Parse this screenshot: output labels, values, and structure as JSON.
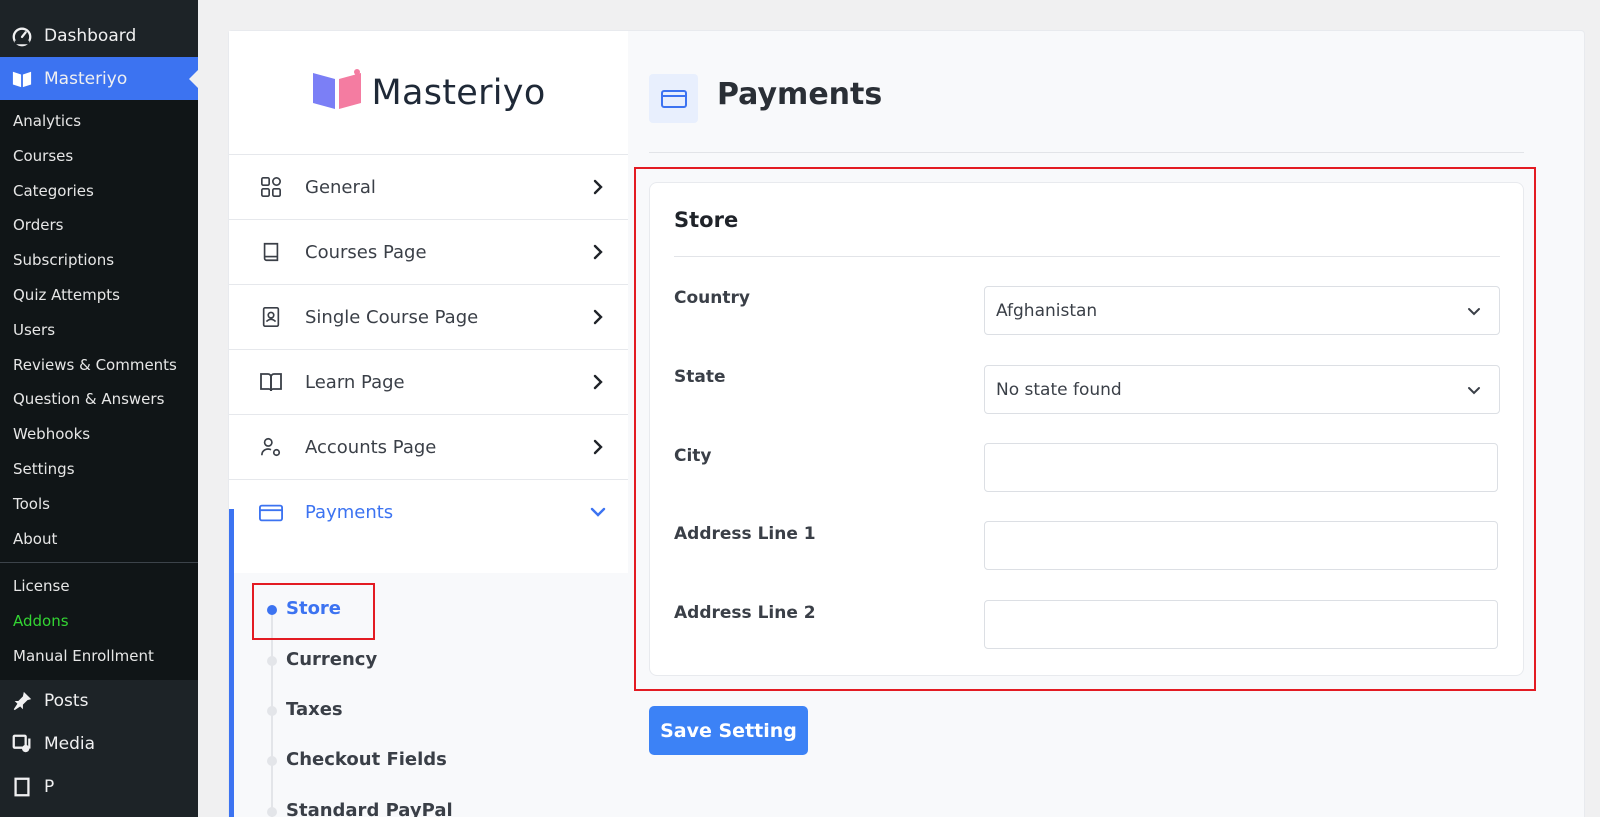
{
  "wp_sidebar": {
    "top_items": [
      {
        "label": "Dashboard",
        "icon": "dashboard-icon"
      },
      {
        "label": "Masteriyo",
        "icon": "masteriyo-book-icon"
      }
    ],
    "submenu": [
      "Analytics",
      "Courses",
      "Categories",
      "Orders",
      "Subscriptions",
      "Quiz Attempts",
      "Users",
      "Reviews & Comments",
      "Question & Answers",
      "Webhooks",
      "Settings",
      "Tools",
      "About"
    ],
    "submenu_extra": [
      "License",
      "Addons",
      "Manual Enrollment"
    ],
    "bottom_items": [
      {
        "label": "Posts",
        "icon": "pin-icon"
      },
      {
        "label": "Media",
        "icon": "media-icon"
      },
      {
        "label": "P",
        "icon": "pages-icon"
      }
    ]
  },
  "logo": {
    "text": "Masteriyo"
  },
  "settings_nav": {
    "items": [
      {
        "label": "General",
        "icon": "grid-icon"
      },
      {
        "label": "Courses Page",
        "icon": "book-icon"
      },
      {
        "label": "Single Course Page",
        "icon": "contact-book-icon"
      },
      {
        "label": "Learn Page",
        "icon": "open-book-icon"
      },
      {
        "label": "Accounts Page",
        "icon": "user-settings-icon"
      },
      {
        "label": "Payments",
        "icon": "credit-card-icon"
      }
    ],
    "payments_subitems": [
      "Store",
      "Currency",
      "Taxes",
      "Checkout Fields",
      "Standard PayPal"
    ]
  },
  "header": {
    "title": "Payments"
  },
  "store_form": {
    "title": "Store",
    "fields": {
      "country_label": "Country",
      "country_value": "Afghanistan",
      "state_label": "State",
      "state_value": "No state found",
      "city_label": "City",
      "city_value": "",
      "address1_label": "Address Line 1",
      "address1_value": "",
      "address2_label": "Address Line 2",
      "address2_value": ""
    }
  },
  "save_button": {
    "label": "Save Setting"
  },
  "colors": {
    "accent": "#3c73f1",
    "highlight": "#e31b23",
    "wp_sidebar_bg": "#1d2327",
    "addons_green": "#33d433"
  }
}
